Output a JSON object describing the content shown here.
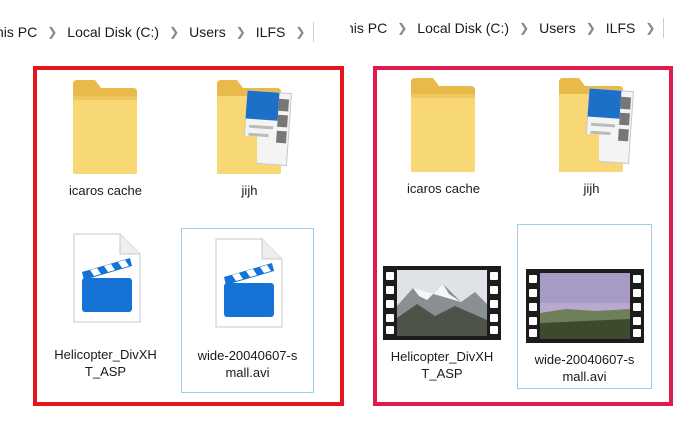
{
  "left": {
    "breadcrumb": [
      "his PC",
      "Local Disk (C:)",
      "Users",
      "ILFS"
    ],
    "items": [
      {
        "label": "icaros cache"
      },
      {
        "label": "jijh"
      },
      {
        "label_lines": [
          "Helicopter_DivXH",
          "T_ASP"
        ]
      },
      {
        "label_lines": [
          "wide-20040607-s",
          "mall.avi"
        ]
      }
    ]
  },
  "right": {
    "breadcrumb": [
      "his PC",
      "Local Disk (C:)",
      "Users",
      "ILFS"
    ],
    "items": [
      {
        "label": "icaros cache"
      },
      {
        "label": "jijh"
      },
      {
        "label_lines": [
          "Helicopter_DivXH",
          "T_ASP"
        ]
      },
      {
        "label_lines": [
          "wide-20040607-s",
          "mall.avi"
        ]
      }
    ]
  },
  "colors": {
    "left_frame": "#e8141b",
    "right_frame": "#e01a4f",
    "selection": "#9ad0ef",
    "folder": "#f8d775"
  }
}
